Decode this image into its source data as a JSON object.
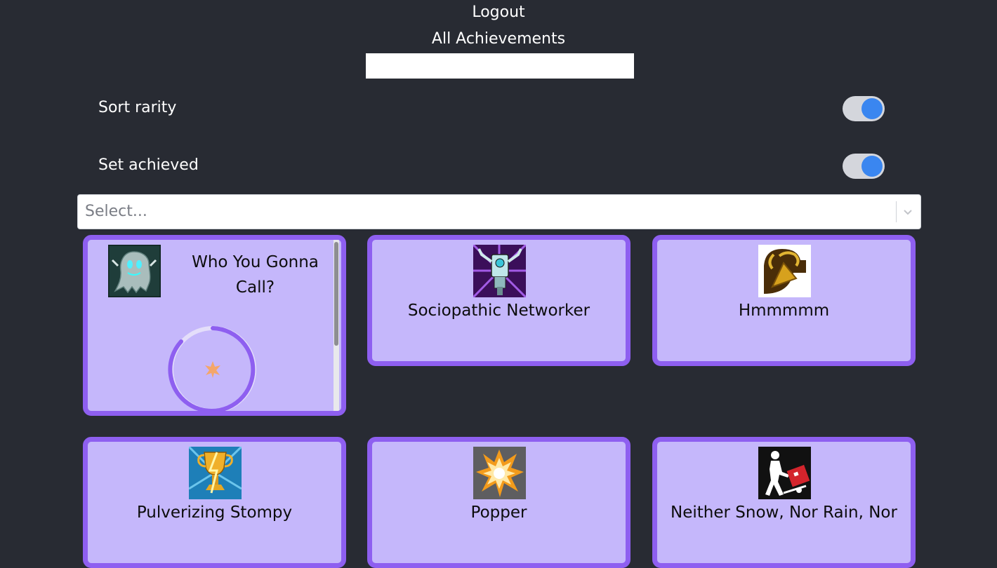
{
  "header": {
    "logout_label": "Logout",
    "all_achievements_label": "All Achievements",
    "name_input_value": ""
  },
  "toggles": [
    {
      "label": "Sort rarity",
      "on": true
    },
    {
      "label": "Set achieved",
      "on": true
    }
  ],
  "select": {
    "placeholder": "Select..."
  },
  "achievements": [
    {
      "name": "Who You Gonna Call?",
      "icon": "ghost-icon",
      "loading": true
    },
    {
      "name": "Sociopathic Networker",
      "icon": "claptrap-icon"
    },
    {
      "name": "Hmmmmm",
      "icon": "gold-key-icon"
    },
    {
      "name": "Pulverizing Stompy",
      "icon": "trophy-lightning-icon"
    },
    {
      "name": "Popper",
      "icon": "explosion-icon"
    },
    {
      "name": "Neither Snow, Nor Rain, Nor",
      "icon": "mail-carrier-icon"
    }
  ],
  "colors": {
    "background": "#282b33",
    "card_fill": "#c5b7fb",
    "card_border": "#8e5ff0",
    "toggle_knob": "#3a86f0"
  }
}
